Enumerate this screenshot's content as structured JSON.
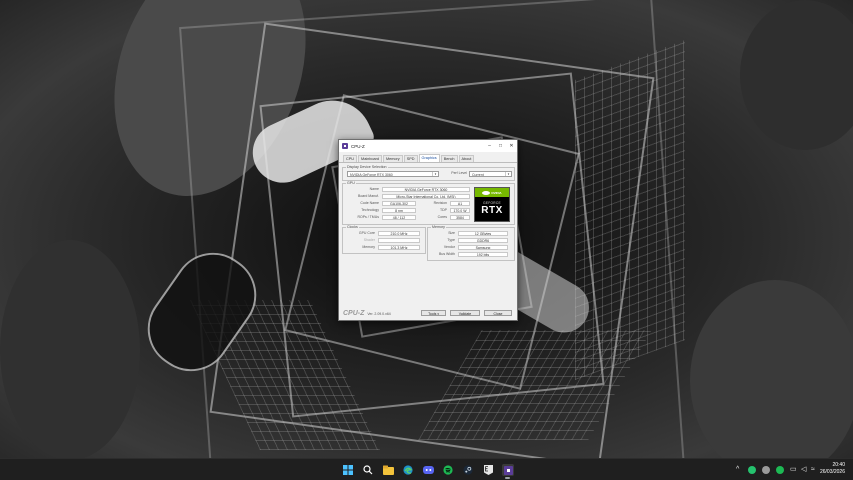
{
  "window": {
    "title": "CPU-Z",
    "minimize_glyph": "–",
    "maximize_glyph": "□",
    "close_glyph": "✕",
    "tabs": [
      "CPU",
      "Mainboard",
      "Memory",
      "SPD",
      "Graphics",
      "Bench",
      "About"
    ],
    "active_tab": "Graphics"
  },
  "display_device": {
    "group_label": "Display Device Selection",
    "device": "NVIDIA GeForce RTX 3060",
    "perf_level_label": "Perf Level",
    "perf_level": "Current"
  },
  "gpu": {
    "group_label": "GPU",
    "name_label": "Name",
    "name": "NVIDIA GeForce RTX 3060",
    "board_manuf_label": "Board Manuf.",
    "board_manuf": "Micro-Star International Co. Ltd. (MSI)",
    "code_name_label": "Code Name",
    "code_name": "GA106-302",
    "revision_label": "Revision",
    "revision": "A1",
    "technology_label": "Technology",
    "technology": "8 nm",
    "tdp_label": "TDP",
    "tdp": "170.0 W",
    "rops_label": "ROPs / TMUs",
    "rops": "48 / 112",
    "cores_label": "Cores",
    "cores": "3584"
  },
  "logo": {
    "brand": "NVIDIA",
    "line1": "GEFORCE",
    "line2": "RTX"
  },
  "clocks": {
    "group_label": "Clocks",
    "gpu_core_label": "GPU Core",
    "gpu_core": "210.0 MHz",
    "shader_label": "Shader",
    "shader": "",
    "memory_label": "Memory",
    "memory": "101.3 MHz"
  },
  "memory": {
    "group_label": "Memory",
    "size_label": "Size",
    "size": "12 GBytes",
    "type_label": "Type",
    "type": "GDDR6",
    "vendor_label": "Vendor",
    "vendor": "Samsung",
    "bus_width_label": "Bus Width",
    "bus_width": "192 bits"
  },
  "footer": {
    "brand": "CPU-Z",
    "version": "Ver. 2.09.0.x64",
    "tools_label": "Tools",
    "validate_label": "Validate",
    "close_label": "Close"
  },
  "taskbar": {
    "time": "20:40",
    "date": "26/03/2026",
    "icons": [
      "windows-start-icon",
      "search-icon",
      "file-explorer-icon",
      "edge-icon",
      "discord-icon",
      "spotify-icon",
      "steam-icon",
      "epic-games-icon",
      "cpu-z-icon"
    ]
  },
  "colors": {
    "taskbar": "#1f1f1f",
    "cpuz_purple": "#5b3d99",
    "nvidia_green": "#76b900"
  }
}
